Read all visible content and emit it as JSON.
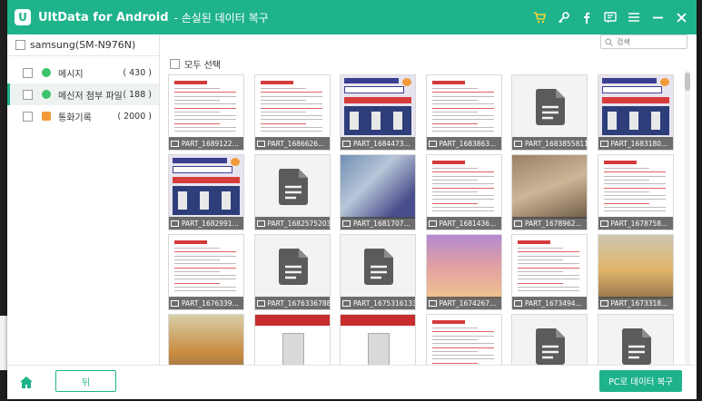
{
  "window": {
    "app_title": "UltData for Android",
    "subtitle": "- 손실된 데이터 복구",
    "logo_letter": "U"
  },
  "titlebar_icons": [
    "cart-icon",
    "key-icon",
    "facebook-icon",
    "chat-icon",
    "menu-icon",
    "minimize-icon",
    "close-icon"
  ],
  "sidebar": {
    "device": "samsung(SM-N976N)",
    "items": [
      {
        "label": "메시지",
        "count": "( 430 )",
        "icon": "message-icon",
        "color": "#3cc46a",
        "selected": false
      },
      {
        "label": "메신저 첨부 파일",
        "count": "( 188 )",
        "icon": "chat-bubble-icon",
        "color": "#3cc46a",
        "selected": true
      },
      {
        "label": "통화기록",
        "count": "( 2000 )",
        "icon": "call-log-icon",
        "color": "#f29a38",
        "selected": false
      }
    ]
  },
  "main": {
    "search_placeholder": "검색",
    "select_all": "모두 선택",
    "tiles": [
      {
        "name": "PART_1689122...",
        "kind": "receipt"
      },
      {
        "name": "PART_1686626...",
        "kind": "receipt"
      },
      {
        "name": "PART_1684473...",
        "kind": "poster"
      },
      {
        "name": "PART_1683863...",
        "kind": "receipt"
      },
      {
        "name": "PART_16838558113...",
        "kind": "doc"
      },
      {
        "name": "PART_1683180...",
        "kind": "poster"
      },
      {
        "name": "PART_1682991...",
        "kind": "poster"
      },
      {
        "name": "PART_16825752030...",
        "kind": "doc"
      },
      {
        "name": "PART_1681707...",
        "kind": "photo-blue"
      },
      {
        "name": "PART_1681436...",
        "kind": "receipt"
      },
      {
        "name": "PART_1678962...",
        "kind": "photo-ticket"
      },
      {
        "name": "PART_1678758...",
        "kind": "receipt"
      },
      {
        "name": "PART_1676339...",
        "kind": "receipt"
      },
      {
        "name": "PART_16763367881...",
        "kind": "doc"
      },
      {
        "name": "PART_16753161336...",
        "kind": "doc"
      },
      {
        "name": "PART_1674267...",
        "kind": "photo-sunset"
      },
      {
        "name": "PART_1673494...",
        "kind": "receipt"
      },
      {
        "name": "PART_1673318...",
        "kind": "photo-store"
      },
      {
        "name": "",
        "kind": "photo-yellow"
      },
      {
        "name": "",
        "kind": "banner"
      },
      {
        "name": "",
        "kind": "banner"
      },
      {
        "name": "",
        "kind": "receipt"
      },
      {
        "name": "",
        "kind": "doc"
      },
      {
        "name": "",
        "kind": "doc"
      }
    ]
  },
  "footer": {
    "back_label": "뒤",
    "recover_label": "PC로 데이터 복구"
  },
  "colors": {
    "brand": "#1fb38b",
    "receipt_red": "#d43a3a"
  }
}
